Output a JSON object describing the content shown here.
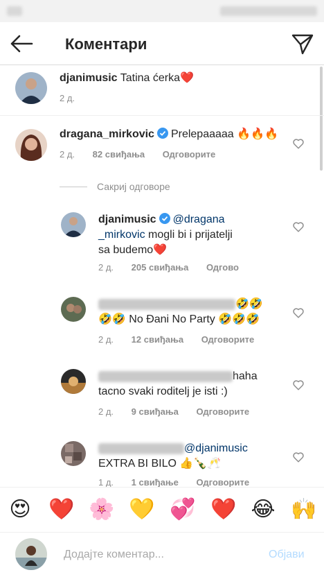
{
  "header": {
    "title": "Коментари"
  },
  "comments": [
    {
      "username": "djanimusic",
      "text": "Tatina ćerka",
      "emoji": "❤️",
      "time": "2 д."
    },
    {
      "username": "dragana_mirkovic",
      "text": "Prelepaaaaa",
      "emoji": "🔥🔥🔥",
      "time": "2 д.",
      "likes": "82 свиђања",
      "reply": "Одговорите"
    }
  ],
  "hide_replies": "Сакриј одговоре",
  "replies": [
    {
      "username": "djanimusic",
      "mention_line1": "@dragana",
      "mention_line2": "_mirkovic",
      "text_line1": " mogli bi i prijatelji",
      "text_line2": "sa budemo",
      "emoji": "❤️",
      "time": "2 д.",
      "likes": "205 свиђања",
      "reply": "Одгово"
    },
    {
      "emoji_line1": "🤣🤣",
      "emoji_prefix": "🤣🤣",
      "text": " No Đani No Party ",
      "emoji_suffix": "🤣🤣🤣",
      "time": "2 д.",
      "likes": "12 свиђања",
      "reply": "Одговорите"
    },
    {
      "text_line1": "haha",
      "text_line2": "tacno svaki roditelj je isti :)",
      "time": "2 д.",
      "likes": "9 свиђања",
      "reply": "Одговорите"
    },
    {
      "mention": "@djanimusic",
      "text": "EXTRA BI BILO ",
      "emoji": "👍🍾🥂",
      "time": "1 д.",
      "likes": "1 свиђање",
      "reply": "Одговорите"
    }
  ],
  "emoji_bar": [
    "😍",
    "❤️",
    "🌸",
    "💛",
    "💞",
    "❤️",
    "😂",
    "🙌"
  ],
  "compose": {
    "placeholder": "Додајте коментар...",
    "post_label": "Објави"
  }
}
